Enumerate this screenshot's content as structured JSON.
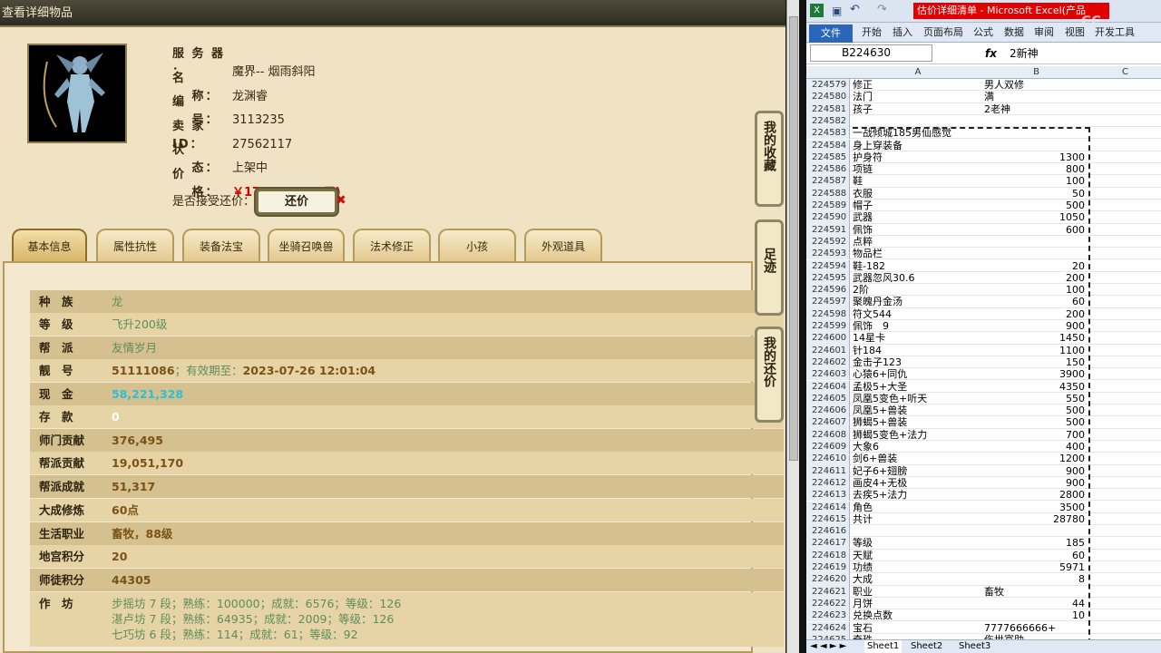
{
  "left_window": {
    "title": "查看详细物品"
  },
  "item": {
    "rows": [
      {
        "k": "服 务 器 ：",
        "v": "魔界-- 烟雨斜阳"
      },
      {
        "k": "名 　 称：",
        "v": "龙渊睿"
      },
      {
        "k": "编 　 号：",
        "v": "3113235"
      },
      {
        "k": "卖 家 ID：",
        "v": "27562117"
      },
      {
        "k": "状 　 态：",
        "v": "上架中"
      },
      {
        "k": "价 　 格：",
        "v": "￥178618.00 (元)"
      }
    ],
    "bargain_label": "是否接受还价：",
    "bargain_button": "还价"
  },
  "tabs": [
    "基本信息",
    "属性抗性",
    "装备法宝",
    "坐骑召唤兽",
    "法术修正",
    "小孩",
    "外观道具"
  ],
  "side_buttons": [
    "我的收藏",
    "足迹",
    "我的还价"
  ],
  "stats": [
    {
      "k": "种　族",
      "v": "龙"
    },
    {
      "k": "等　级",
      "v": "飞升200级"
    },
    {
      "k": "帮　派",
      "v": "友情岁月"
    },
    {
      "k": "靓　号",
      "v": "51111086",
      "v2": "；有效期至：",
      "v3": "2023-07-26 12:01:04"
    },
    {
      "k": "现　金",
      "v": "58,221,328"
    },
    {
      "k": "存　款",
      "v": "0"
    },
    {
      "k": "师门贡献",
      "v": "376,495"
    },
    {
      "k": "帮派贡献",
      "v": "19,051,170"
    },
    {
      "k": "帮派成就",
      "v": "51,317"
    },
    {
      "k": "大成修炼",
      "v": "60点"
    },
    {
      "k": "生活职业",
      "v": "畜牧，88级"
    },
    {
      "k": "地宫积分",
      "v": "20"
    },
    {
      "k": "师徒积分",
      "v": "44305"
    },
    {
      "k": "作　坊",
      "v": "步摇坊 7 段；熟练：100000；成就：6576；等级：126",
      "v2": "湛卢坊 7 段；熟练：64935；成就：2009；等级：126",
      "v3": "七巧坊 6 段；熟练：114；成就：61；等级：92"
    }
  ],
  "excel": {
    "title": "估价详细清单 - Microsoft Excel(产品",
    "ribbon_file": "文件",
    "ribbon_tabs": [
      "开始",
      "插入",
      "页面布局",
      "公式",
      "数据",
      "审阅",
      "视图",
      "开发工具"
    ],
    "name_box": "B224630",
    "fx": "fx",
    "formula_value": "2新神",
    "col_headers": [
      "A",
      "B",
      "C"
    ],
    "rows": [
      {
        "n": "224579",
        "a": "修正",
        "b": "男人双修"
      },
      {
        "n": "224580",
        "a": "法门",
        "b": "满"
      },
      {
        "n": "224581",
        "a": "孩子",
        "b": "2老神"
      },
      {
        "n": "224582",
        "a": "",
        "b": ""
      },
      {
        "n": "224583",
        "a": "一战倾城185男仙感觉",
        "b": ""
      },
      {
        "n": "224584",
        "a": "身上穿装备",
        "b": ""
      },
      {
        "n": "224585",
        "a": "护身符",
        "b": "1300"
      },
      {
        "n": "224586",
        "a": "项链",
        "b": "800"
      },
      {
        "n": "224587",
        "a": "鞋",
        "b": "100"
      },
      {
        "n": "224588",
        "a": "衣服",
        "b": "50"
      },
      {
        "n": "224589",
        "a": "帽子",
        "b": "500"
      },
      {
        "n": "224590",
        "a": "武器",
        "b": "1050"
      },
      {
        "n": "224591",
        "a": "佩饰",
        "b": "600"
      },
      {
        "n": "224592",
        "a": "点粹",
        "b": ""
      },
      {
        "n": "224593",
        "a": "物品栏",
        "b": ""
      },
      {
        "n": "224594",
        "a": "鞋-182",
        "b": "20"
      },
      {
        "n": "224595",
        "a": "武器忽风30.6",
        "b": "200"
      },
      {
        "n": "224596",
        "a": "2阶",
        "b": "100"
      },
      {
        "n": "224597",
        "a": "聚魄丹金汤",
        "b": "60"
      },
      {
        "n": "224598",
        "a": "符文544",
        "b": "200"
      },
      {
        "n": "224599",
        "a": "佩饰　9",
        "b": "900"
      },
      {
        "n": "224600",
        "a": "14星卡",
        "b": "1450"
      },
      {
        "n": "224601",
        "a": "针184",
        "b": "1100"
      },
      {
        "n": "224602",
        "a": "金击子123",
        "b": "150"
      },
      {
        "n": "224603",
        "a": "心猿6+同仇",
        "b": "3900"
      },
      {
        "n": "224604",
        "a": "孟极5+大圣",
        "b": "4350"
      },
      {
        "n": "224605",
        "a": "凤凰5变色+听天",
        "b": "550"
      },
      {
        "n": "224606",
        "a": "凤凰5+兽装",
        "b": "500"
      },
      {
        "n": "224607",
        "a": "狮蝎5+兽装",
        "b": "500"
      },
      {
        "n": "224608",
        "a": "狮蝎5变色+法力",
        "b": "700"
      },
      {
        "n": "224609",
        "a": "大象6",
        "b": "400"
      },
      {
        "n": "224610",
        "a": "剑6+兽装",
        "b": "1200"
      },
      {
        "n": "224611",
        "a": "妃子6+翅膀",
        "b": "900"
      },
      {
        "n": "224612",
        "a": "画皮4+无极",
        "b": "900"
      },
      {
        "n": "224613",
        "a": "去疾5+法力",
        "b": "2800"
      },
      {
        "n": "224614",
        "a": "角色",
        "b": "3500"
      },
      {
        "n": "224615",
        "a": "共计",
        "b": "28780"
      },
      {
        "n": "224616",
        "a": "",
        "b": ""
      },
      {
        "n": "224617",
        "a": "等级",
        "b": "185"
      },
      {
        "n": "224618",
        "a": "天赋",
        "b": "60"
      },
      {
        "n": "224619",
        "a": "功绩",
        "b": "5971"
      },
      {
        "n": "224620",
        "a": "大成",
        "b": "8"
      },
      {
        "n": "224621",
        "a": "职业",
        "b": "畜牧"
      },
      {
        "n": "224622",
        "a": "月饼",
        "b": "44"
      },
      {
        "n": "224623",
        "a": "兑换点数",
        "b": "10"
      },
      {
        "n": "224624",
        "a": "宝石",
        "b": "7777666666+"
      },
      {
        "n": "224625",
        "a": "奇珠",
        "b": "伤世宴助"
      }
    ],
    "sheets": [
      "Sheet1",
      "Sheet2",
      "Sheet3"
    ]
  },
  "watermark": "CC"
}
